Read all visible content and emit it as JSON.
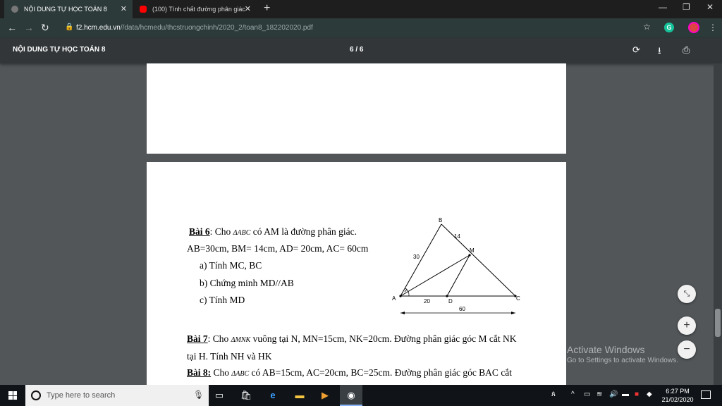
{
  "tabs": [
    {
      "title": "NỘI DUNG TỰ HỌC TOÁN 8",
      "icon": "globe-icon"
    },
    {
      "title": "(100) Tính chất đường phân giác",
      "icon": "youtube-icon"
    }
  ],
  "address": {
    "host": "f2.hcm.edu.vn",
    "path": "//data/hcmedu/thcstruongchinh/2020_2/toan8_182202020.pdf"
  },
  "pdf": {
    "title": "NỘI DUNG TỰ HỌC TOÁN 8",
    "page": "6 / 6"
  },
  "doc": {
    "bai6_label": "Bài 6",
    "bai6_text1": ": Cho ",
    "bai6_tri": "ΔABC",
    "bai6_text2": " có AM là đường phân giác.",
    "bai6_line2": "AB=30cm, BM= 14cm, AD= 20cm, AC= 60cm",
    "bai6_a": "a)  Tính MC, BC",
    "bai6_b": "b)  Chứng minh MD//AB",
    "bai6_c": "c)  Tính MD",
    "bai7_label": "Bài 7",
    "bai7_text1": ": Cho ",
    "bai7_tri": "ΔMNK",
    "bai7_text2": "  vuông tại N, MN=15cm, NK=20cm. Đường phân giác góc M cắt NK",
    "bai7_line2": "tại H. Tính NH và HK",
    "bai8_label": "Bài 8:",
    "bai8_text1": " Cho ",
    "bai8_tri": "ΔABC",
    "bai8_text2": "  có AB=15cm, AC=20cm, BC=25cm. Đường phân giác góc BAC cắt"
  },
  "figure": {
    "labels": {
      "B": "B",
      "M": "M",
      "A": "A",
      "D": "D",
      "C": "C"
    },
    "len_ab": "30",
    "len_bm": "14",
    "len_ad": "20",
    "len_ac": "60"
  },
  "activate": {
    "line1": "Activate Windows",
    "line2": "Go to Settings to activate Windows."
  },
  "taskbar": {
    "search_placeholder": "Type here to search",
    "time": "6:27 PM",
    "date": "21/02/2020"
  }
}
